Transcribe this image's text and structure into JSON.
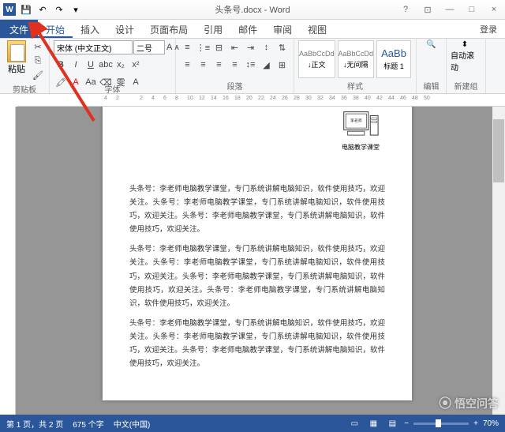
{
  "title": {
    "filename": "头条号.docx",
    "app": "Word"
  },
  "win": {
    "help": "?",
    "restore": "⊡",
    "min": "—",
    "max": "□",
    "close": "×"
  },
  "tabs": {
    "file": "文件",
    "items": [
      "开始",
      "插入",
      "设计",
      "页面布局",
      "引用",
      "邮件",
      "审阅",
      "视图"
    ],
    "active_index": 0,
    "signin": "登录"
  },
  "clipboard": {
    "paste": "粘贴",
    "label": "剪贴板"
  },
  "font": {
    "name": "宋体 (中文正文)",
    "size": "二号",
    "bold": "B",
    "italic": "I",
    "underline": "U",
    "label": "字体"
  },
  "paragraph": {
    "label": "段落"
  },
  "styles": {
    "label": "样式",
    "items": [
      {
        "preview": "AaBbCcDd",
        "name": "↓正文"
      },
      {
        "preview": "AaBbCcDd",
        "name": "↓无间隔"
      },
      {
        "preview": "AaBb",
        "name": "标题 1"
      }
    ]
  },
  "editing": {
    "label": "编辑"
  },
  "newgroup": {
    "auto_scroll": "自动滚动",
    "label": "新建组"
  },
  "ruler": {
    "marks": [
      "4",
      "2",
      "",
      "2",
      "4",
      "6",
      "8",
      "10",
      "12",
      "14",
      "16",
      "18",
      "20",
      "22",
      "24",
      "26",
      "28",
      "30",
      "32",
      "34",
      "36",
      "38",
      "40",
      "42",
      "44",
      "46",
      "48",
      "50"
    ]
  },
  "doc": {
    "header_text": "电脑教学课堂",
    "para1": "头条号：李老师电脑教学课堂，专门系统讲解电脑知识，软件使用技巧，欢迎关注。头条号：李老师电脑教学课堂，专门系统讲解电脑知识，软件使用技巧，欢迎关注。头条号：李老师电脑教学课堂，专门系统讲解电脑知识，软件使用技巧，欢迎关注。",
    "para2": "头条号：李老师电脑教学课堂，专门系统讲解电脑知识，软件使用技巧，欢迎关注。头条号：李老师电脑教学课堂，专门系统讲解电脑知识，软件使用技巧，欢迎关注。头条号：李老师电脑教学课堂，专门系统讲解电脑知识，软件使用技巧，欢迎关注。头条号：李老师电脑教学课堂，专门系统讲解电脑知识，软件使用技巧，欢迎关注。",
    "para3": "头条号：李老师电脑教学课堂，专门系统讲解电脑知识，软件使用技巧，欢迎关注。头条号：李老师电脑教学课堂，专门系统讲解电脑知识，软件使用技巧，欢迎关注。头条号：李老师电脑教学课堂，专门系统讲解电脑知识，软件使用技巧，欢迎关注。"
  },
  "status": {
    "page": "第 1 页，共 2 页",
    "words": "675 个字",
    "lang": "中文(中国)",
    "zoom": "70%",
    "zoom_minus": "−",
    "zoom_plus": "+"
  },
  "watermark": "悟空问答"
}
